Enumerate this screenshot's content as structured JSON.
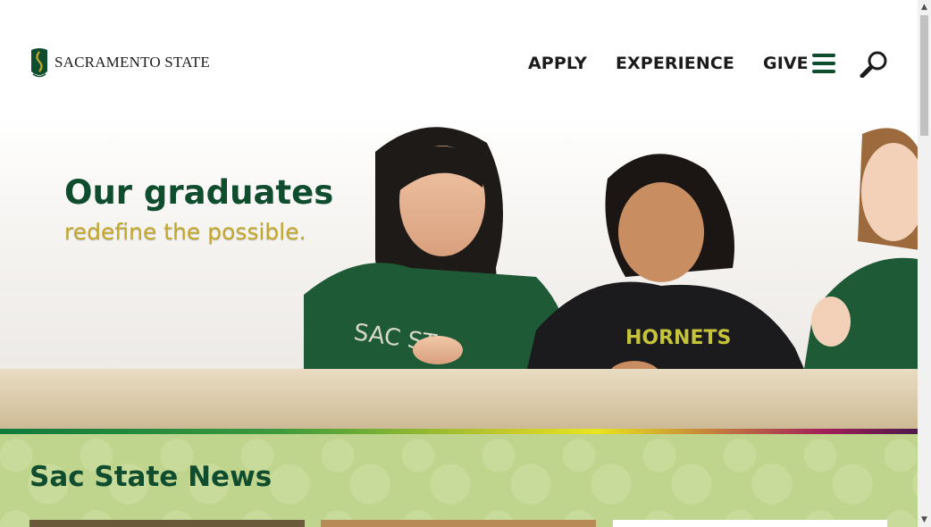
{
  "brand": {
    "name": "SACRAMENTO STATE",
    "green": "#0f4d2e",
    "gold": "#c4a82a"
  },
  "nav": {
    "items": [
      {
        "label": "APPLY"
      },
      {
        "label": "EXPERIENCE"
      },
      {
        "label": "GIVE"
      }
    ],
    "menu_icon": "hamburger-icon",
    "search_icon": "search-icon"
  },
  "hero": {
    "title": "Our graduates",
    "subtitle": "redefine the possible."
  },
  "news": {
    "title": "Sac State News"
  },
  "scrollbar": {
    "up": "▲",
    "down": "▼"
  }
}
